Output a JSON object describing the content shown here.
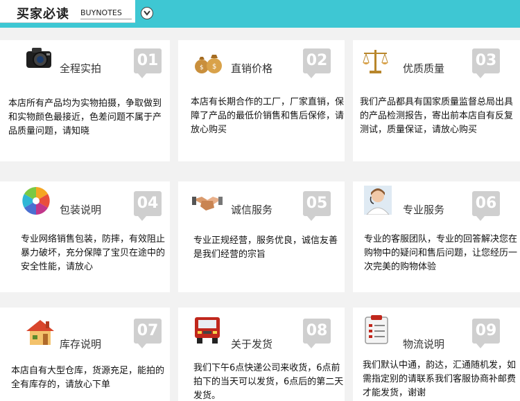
{
  "header": {
    "title": "买家必读",
    "subtitle": "BUYNOTES"
  },
  "cards": [
    {
      "number": "01",
      "title": "全程实拍",
      "icon": "camera-icon",
      "text": "本店所有产品均为实物拍摄，争取做到和实物颜色最接近，色差问题不属于产品质量问题，请知晓"
    },
    {
      "number": "02",
      "title": "直销价格",
      "icon": "money-bags-icon",
      "text": "本店有长期合作的工厂，厂家直销，保障了产品的最低价销售和售后保修，请放心购买"
    },
    {
      "number": "03",
      "title": "优质质量",
      "icon": "scales-icon",
      "text": "我们产品都具有国家质量监督总局出具的产品检测报告，寄出前本店自有反复测试，质量保证，请放心购买"
    },
    {
      "number": "04",
      "title": "包装说明",
      "icon": "color-wheel-icon",
      "text": "专业网络销售包装，防摔，有效阻止暴力破坏，充分保障了宝贝在途中的安全性能，请放心"
    },
    {
      "number": "05",
      "title": "诚信服务",
      "icon": "handshake-icon",
      "text": "专业正规经营，服务优良，诚信友善是我们经营的宗旨"
    },
    {
      "number": "06",
      "title": "专业服务",
      "icon": "support-agent-icon",
      "text": "专业的客服团队，专业的回答解决您在购物中的疑问和售后问题，让您经历一次完美的购物体验"
    },
    {
      "number": "07",
      "title": "库存说明",
      "icon": "warehouse-icon",
      "text": "本店自有大型仓库，货源充足，能拍的全有库存的，请放心下单"
    },
    {
      "number": "08",
      "title": "关于发货",
      "icon": "truck-icon",
      "text": "我们下午6点快递公司来收货，6点前拍下的当天可以发货，6点后的第二天发货。"
    },
    {
      "number": "09",
      "title": "物流说明",
      "icon": "clipboard-icon",
      "text": "我们默认中通，韵达，汇通随机发，如需指定别的请联系我们客服协商补邮费才能发货，谢谢"
    }
  ]
}
